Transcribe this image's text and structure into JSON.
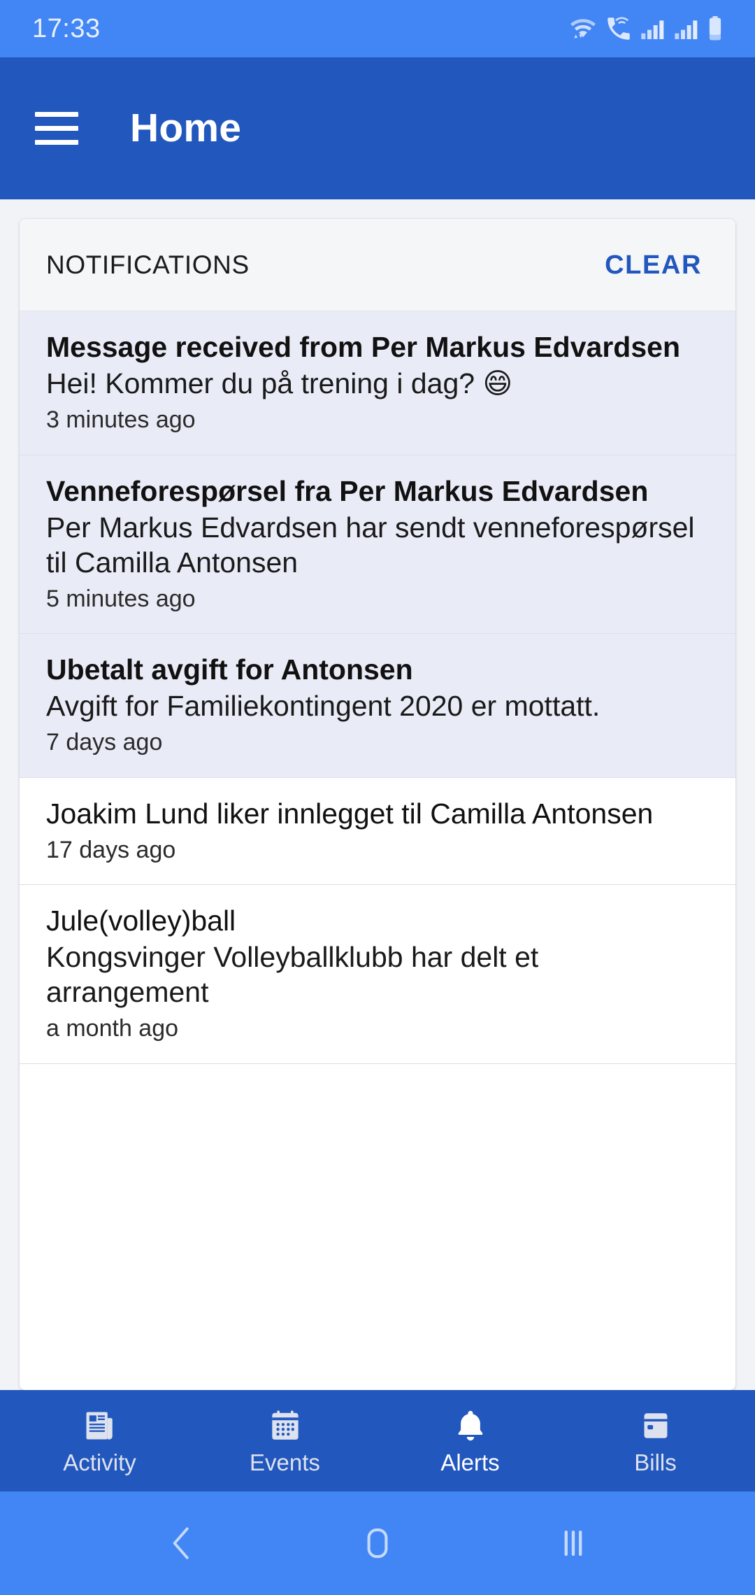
{
  "statusbar": {
    "time": "17:33",
    "icons": [
      "wifi-data-icon",
      "wifi-calling-icon",
      "signal-bars-icon",
      "signal-bars-2-icon",
      "battery-icon"
    ]
  },
  "appbar": {
    "menu_icon": "hamburger-menu-icon",
    "title": "Home",
    "background": "#2257bd"
  },
  "card": {
    "header_title": "NOTIFICATIONS",
    "clear_label": "CLEAR",
    "clear_color": "#2257bd"
  },
  "notifications": [
    {
      "title": "Message received from Per Markus Edvardsen",
      "body": "Hei! Kommer du på trening i dag? 😄",
      "time": "3 minutes ago",
      "read": false,
      "bold_title": true
    },
    {
      "title": "Venneforespørsel fra Per Markus Edvardsen",
      "body": "Per Markus Edvardsen har sendt venneforespørsel til Camilla Antonsen",
      "time": "5 minutes ago",
      "read": false,
      "bold_title": true
    },
    {
      "title": "Ubetalt avgift for Antonsen",
      "body": "Avgift for Familiekontingent 2020 er mottatt.",
      "time": "7 days ago",
      "read": false,
      "bold_title": true
    },
    {
      "title": "Joakim Lund liker innlegget til Camilla Antonsen",
      "body": "",
      "time": "17 days ago",
      "read": true,
      "bold_title": false
    },
    {
      "title": "Jule(volley)ball",
      "body": "Kongsvinger Volleyballklubb har delt et arrangement",
      "time": "a month ago",
      "read": true,
      "bold_title": false
    }
  ],
  "bottomnav": {
    "items": [
      {
        "label": "Activity",
        "icon": "newspaper-icon",
        "active": false
      },
      {
        "label": "Events",
        "icon": "calendar-icon",
        "active": false
      },
      {
        "label": "Alerts",
        "icon": "bell-icon",
        "active": true
      },
      {
        "label": "Bills",
        "icon": "credit-card-icon",
        "active": false
      }
    ]
  },
  "sysnav": {
    "back": "back-chevron-icon",
    "home": "home-square-icon",
    "recents": "recents-bars-icon"
  }
}
